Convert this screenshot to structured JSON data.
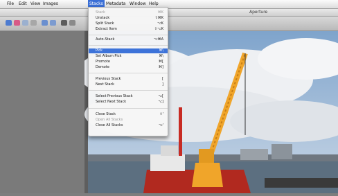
{
  "menubar": {
    "items": [
      "File",
      "Edit",
      "View",
      "Images",
      "Stacks",
      "Metadata",
      "Window",
      "Help"
    ],
    "active_index": 4
  },
  "window": {
    "title": "Aperture"
  },
  "stacks_menu": {
    "items": [
      {
        "label": "Stack",
        "shortcut": "⌘K",
        "disabled": true
      },
      {
        "label": "Unstack",
        "shortcut": "⇧⌘K"
      },
      {
        "label": "Split Stack",
        "shortcut": "⌥K"
      },
      {
        "label": "Extract Item",
        "shortcut": "⇧⌥K"
      },
      {
        "label": "Auto-Stack",
        "shortcut": "⌥⌘A"
      },
      {
        "label": "Pick",
        "shortcut": "⌘\\",
        "selected": true
      },
      {
        "label": "Set Album Pick",
        "shortcut": "⌘\\"
      },
      {
        "label": "Promote",
        "shortcut": "⌘["
      },
      {
        "label": "Demote",
        "shortcut": "⌘]"
      },
      {
        "label": "Previous Stack",
        "shortcut": "["
      },
      {
        "label": "Next Stack",
        "shortcut": "]"
      },
      {
        "label": "Select Previous Stack",
        "shortcut": "⌥["
      },
      {
        "label": "Select Next Stack",
        "shortcut": "⌥]"
      },
      {
        "label": "Close Stack",
        "shortcut": "⇧'"
      },
      {
        "label": "Open All Stacks",
        "shortcut": "",
        "disabled": true
      },
      {
        "label": "Close All Stacks",
        "shortcut": "⌥'"
      }
    ]
  },
  "colors": {
    "menu_highlight": "#3d73d9",
    "accent_crane": "#f0a52a"
  }
}
